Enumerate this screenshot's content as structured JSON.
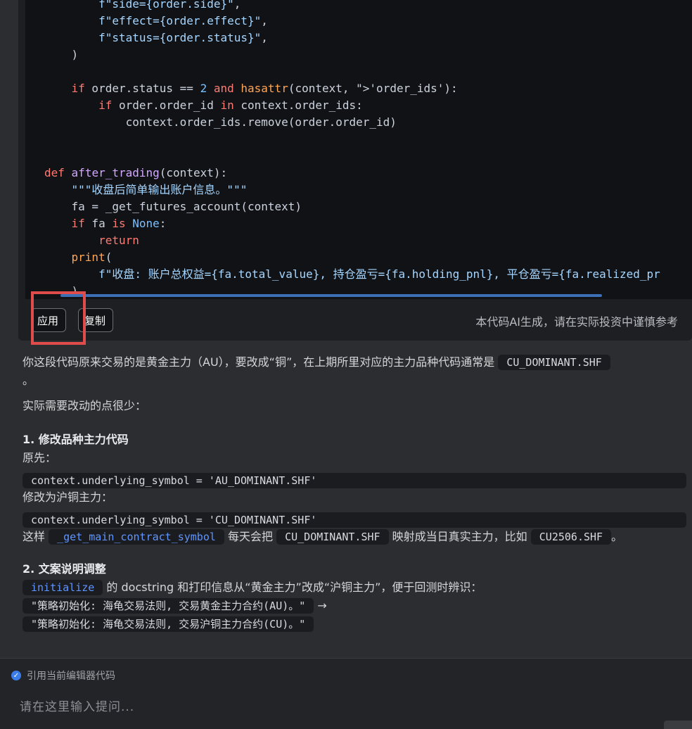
{
  "code": {
    "lines": [
      "        f\"side={order.side}\",",
      "        f\"effect={order.effect}\",",
      "        f\"status={order.status}\",",
      "    )",
      "",
      "    if order.status == 2 and hasattr(context, 'order_ids'):",
      "        if order.order_id in context.order_ids:",
      "            context.order_ids.remove(order.order_id)",
      "",
      "",
      "def after_trading(context):",
      "    \"\"\"收盘后简单输出账户信息。\"\"\"",
      "    fa = _get_futures_account(context)",
      "    if fa is None:",
      "        return",
      "    print(",
      "        f\"收盘: 账户总权益={fa.total_value}, 持仓盈亏={fa.holding_pnl}, 平仓盈亏={fa.realized_pr",
      "    )"
    ]
  },
  "actions": {
    "apply_label": "应用",
    "copy_label": "复制",
    "disclaimer": "本代码AI生成，请在实际投资中谨慎参考"
  },
  "answer": {
    "intro_text": "你这段代码原来交易的是黄金主力（AU），要改成“铜”，在上期所里对应的主力品种代码通常是",
    "intro_code": "CU_DOMINANT.SHF",
    "intro_end": "。",
    "changes_title": "实际需要改动的点很少：",
    "step1_title": "1. 修改品种主力代码",
    "step1_original_label": "原先：",
    "step1_original_code": "context.underlying_symbol = 'AU_DOMINANT.SHF'",
    "step1_new_label": "修改为沪铜主力：",
    "step1_new_code": "context.underlying_symbol = 'CU_DOMINANT.SHF'",
    "step1_note_prefix": "这样",
    "step1_note_func": "_get_main_contract_symbol",
    "step1_note_mid": "每天会把",
    "step1_note_code": "CU_DOMINANT.SHF",
    "step1_note_mid2": "映射成当日真实主力，比如",
    "step1_note_example": "CU2506.SHF",
    "step1_note_end": "。",
    "step2_title": "2. 文案说明调整",
    "step2_func": "initialize",
    "step2_text": "的 docstring 和打印信息从“黄金主力”改成“沪铜主力”，便于回测时辨识：",
    "step2_old_str": "\"策略初始化: 海龟交易法则, 交易黄金主力合约(AU)。\"",
    "step2_arrow": "→",
    "step2_new_str": "\"策略初始化: 海龟交易法则, 交易沪铜主力合约(CU)。\""
  },
  "composer": {
    "reference_label": "引用当前编辑器代码",
    "placeholder": "请在这里输入提问..."
  }
}
